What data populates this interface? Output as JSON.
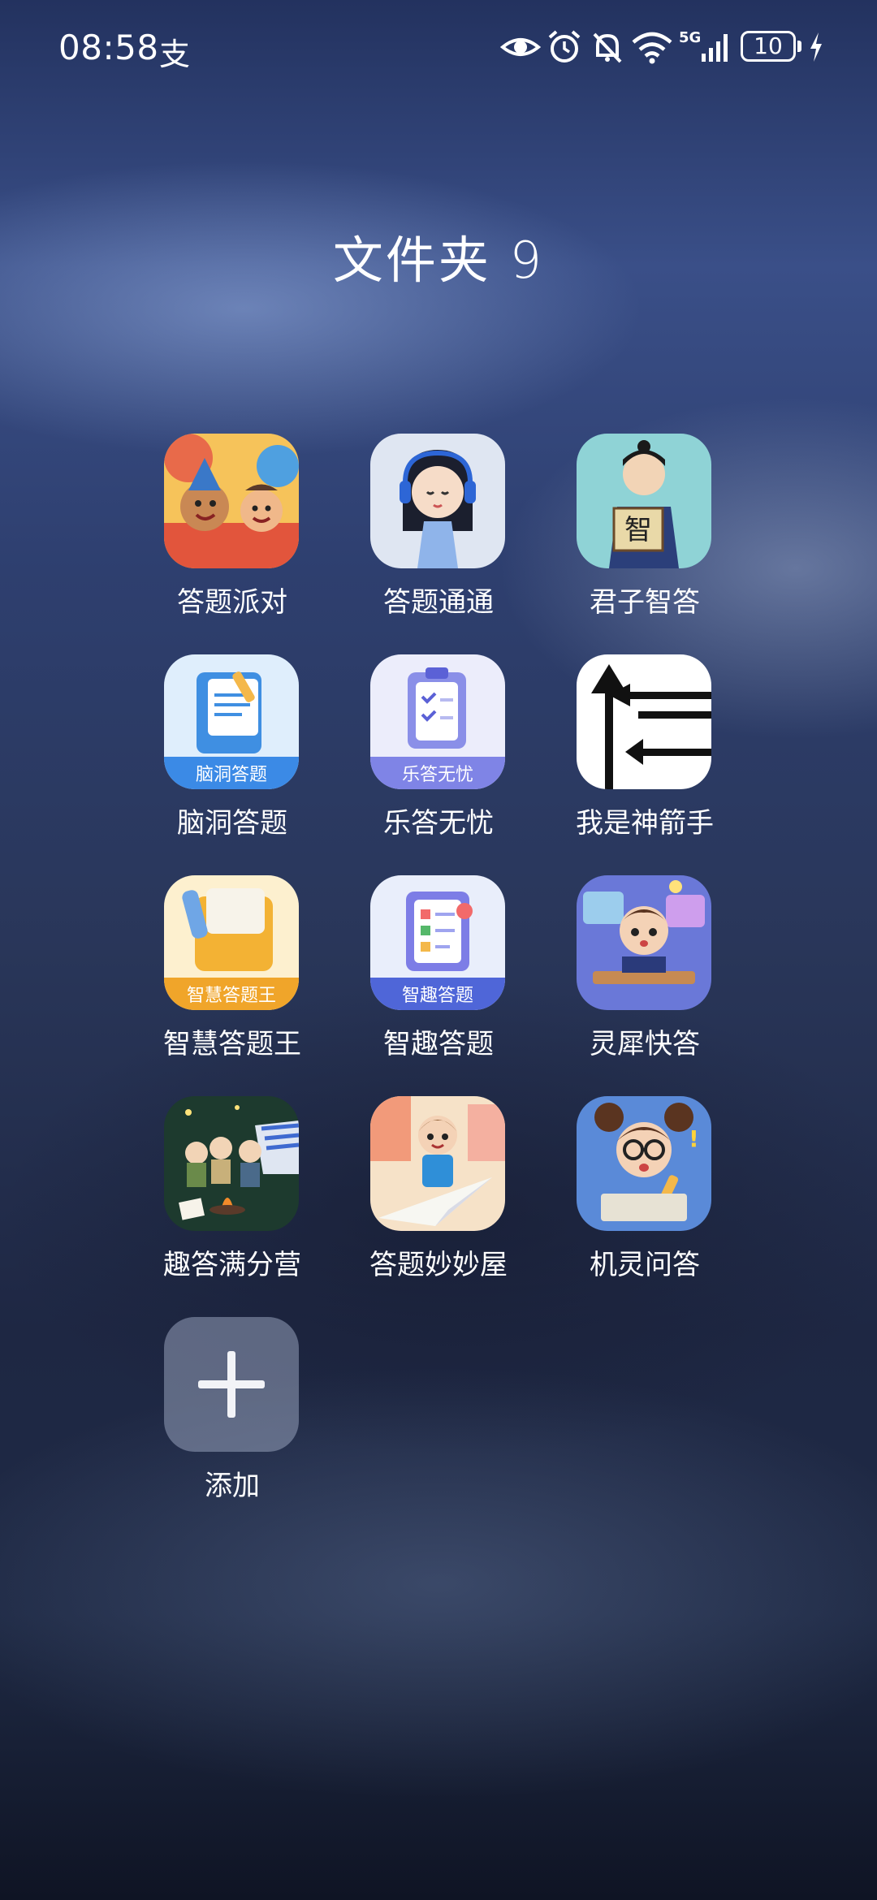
{
  "status_bar": {
    "time": "08:58",
    "carrier_glyph": "支",
    "network": "5G",
    "battery": "10",
    "icons": [
      "eye-icon",
      "alarm-icon",
      "bell-muted-icon",
      "wifi-icon",
      "signal-icon",
      "battery-icon",
      "charging-icon"
    ]
  },
  "folder": {
    "title": "文件夹 9",
    "apps": [
      {
        "label": "答题派对",
        "icon": "party-kids-icon"
      },
      {
        "label": "答题通通",
        "icon": "headphone-girl-icon"
      },
      {
        "label": "君子智答",
        "icon": "scholar-icon"
      },
      {
        "label": "脑洞答题",
        "icon": "notebook-icon",
        "badge": "脑洞答题"
      },
      {
        "label": "乐答无忧",
        "icon": "clipboard-icon",
        "badge": "乐答无忧"
      },
      {
        "label": "我是神箭手",
        "icon": "arrows-icon"
      },
      {
        "label": "智慧答题王",
        "icon": "folder-pen-icon",
        "badge": "智慧答题王"
      },
      {
        "label": "智趣答题",
        "icon": "checklist-icon",
        "badge": "智趣答题"
      },
      {
        "label": "灵犀快答",
        "icon": "study-boy-icon"
      },
      {
        "label": "趣答满分营",
        "icon": "campfire-icon"
      },
      {
        "label": "答题妙妙屋",
        "icon": "paper-plane-boy-icon"
      },
      {
        "label": "机灵问答",
        "icon": "glasses-girl-icon"
      }
    ],
    "add_label": "添加"
  }
}
